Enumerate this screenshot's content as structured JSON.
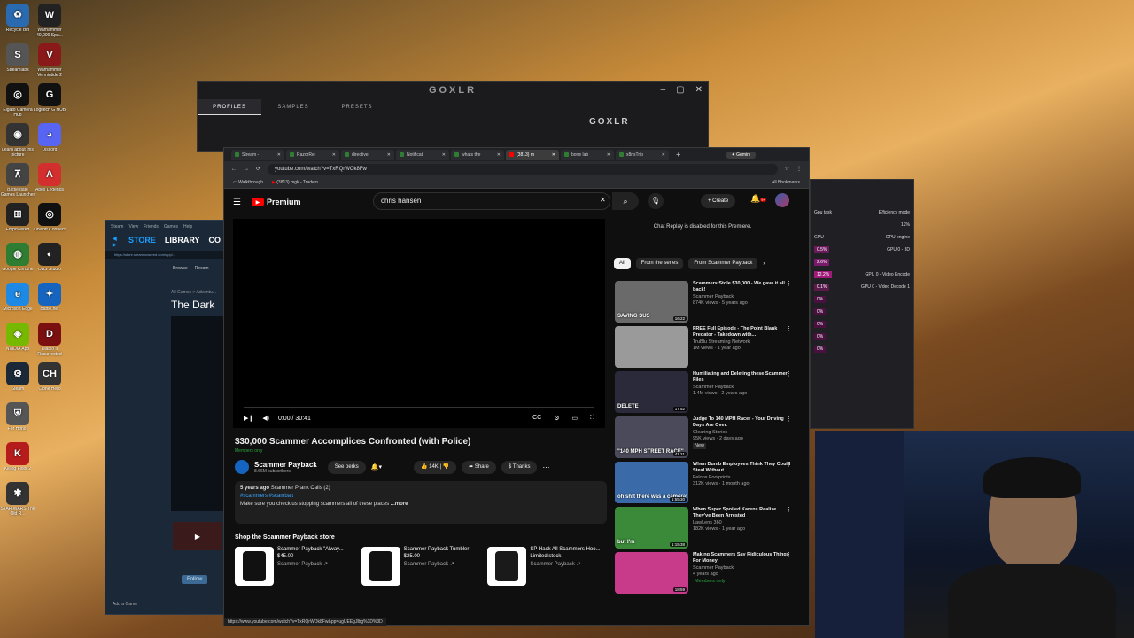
{
  "desktop": {
    "left_icons": [
      {
        "label": "Recycle Bin",
        "color": "#2a6ab0",
        "glyph": "♻"
      },
      {
        "label": "Streamlabs",
        "color": "#555555",
        "glyph": "S"
      },
      {
        "label": "Elgato Camera Hub",
        "color": "#111111",
        "glyph": "◎"
      },
      {
        "label": "Learn about this picture",
        "color": "#333333",
        "glyph": "◉"
      },
      {
        "label": "Battlestate Games Launcher",
        "color": "#444444",
        "glyph": "⊼"
      },
      {
        "label": "Empowered",
        "color": "#222222",
        "glyph": "⊞"
      },
      {
        "label": "Google Chrome",
        "color": "#2e7d32",
        "glyph": "◍"
      },
      {
        "label": "Microsoft Edge",
        "color": "#1e88e5",
        "glyph": "e"
      },
      {
        "label": "NVIDIA App",
        "color": "#76b900",
        "glyph": "◈"
      },
      {
        "label": "Steam",
        "color": "#1b2838",
        "glyph": "⚙"
      },
      {
        "label": "For Honor",
        "color": "#555555",
        "glyph": "⛨"
      },
      {
        "label": "Killing Floor 2",
        "color": "#b71c1c",
        "glyph": "K"
      },
      {
        "label": "STAR WARS The Old R...",
        "color": "#333333",
        "glyph": "✱"
      }
    ],
    "right_icons": [
      {
        "label": "Warhammer 40,000 Spa...",
        "color": "#222222",
        "glyph": "W"
      },
      {
        "label": "Warhammer Vermintide 2",
        "color": "#8a1a1a",
        "glyph": "V"
      },
      {
        "label": "Logitech G HUB",
        "color": "#111111",
        "glyph": "G"
      },
      {
        "label": "Discord",
        "color": "#5865f2",
        "glyph": "◕"
      },
      {
        "label": "Apex Legends",
        "color": "#d32f2f",
        "glyph": "A"
      },
      {
        "label": "Ubisoft Connect",
        "color": "#111111",
        "glyph": "◎"
      },
      {
        "label": "OBS Studio",
        "color": "#222222",
        "glyph": "◐"
      },
      {
        "label": "Battle.net",
        "color": "#1565c0",
        "glyph": "✦"
      },
      {
        "label": "Diablo II Resurrected",
        "color": "#7a1010",
        "glyph": "D"
      },
      {
        "label": "Clone Hero",
        "color": "#333333",
        "glyph": "CH"
      }
    ]
  },
  "goxlr": {
    "title": "GOXLR",
    "tabs": [
      "PROFILES",
      "SAMPLES",
      "PRESETS"
    ],
    "device_label": "GOXLR"
  },
  "steam": {
    "menu": [
      "Steam",
      "View",
      "Friends",
      "Games",
      "Help"
    ],
    "nav": [
      "STORE",
      "LIBRARY",
      "CO"
    ],
    "url": "https://store.steampowered.com/app/...",
    "browse": "Browse",
    "recommend": "Recom",
    "breadcrumb": "All Games > Adventu...",
    "game_title": "The Dark",
    "follow": "Follow",
    "add_game": "Add a Game"
  },
  "taskmgr": {
    "header_left": "Gpu task",
    "header_right": "Efficiency mode",
    "col1": "GPU",
    "col2": "GPU engine",
    "top_pct": "12%",
    "rows": [
      {
        "pct": "0.5%",
        "engine": "GPU 0 - 3D",
        "color": "#6a1a5a"
      },
      {
        "pct": "2.6%",
        "engine": "",
        "color": "#7a1a6a"
      },
      {
        "pct": "12.2%",
        "engine": "GPU 0 - Video Encode",
        "color": "#a01a7a"
      },
      {
        "pct": "0.1%",
        "engine": "GPU 0 - Video Decode 1",
        "color": "#5a1a4a"
      },
      {
        "pct": "0%",
        "engine": "",
        "color": "#4a1040"
      },
      {
        "pct": "0%",
        "engine": "",
        "color": "#4a1040"
      },
      {
        "pct": "0%",
        "engine": "",
        "color": "#4a1040"
      },
      {
        "pct": "0%",
        "engine": "",
        "color": "#4a1040"
      },
      {
        "pct": "0%",
        "engine": "",
        "color": "#4a1040"
      }
    ]
  },
  "browser": {
    "tabs": [
      "Stream -",
      "RazorRe",
      "directive",
      "Notificat",
      "whats the",
      "(3813) m",
      "bone lab",
      "x8nsTrip"
    ],
    "active_tab_index": 5,
    "gemini": "Gemini",
    "url": "youtube.com/watch?v=TxRQrWOk8Fw",
    "bookmarks": [
      "Walkthrough",
      "(3813) mgk - Tradem..."
    ],
    "all_bookmarks": "All Bookmarks",
    "status_url": "https://www.youtube.com/watch?v=TxRQrWOk8Fw&pp=ugUEEgJlbg%3D%3D"
  },
  "youtube": {
    "logo_text": "Premium",
    "search_value": "chris hansen",
    "create_label": "Create",
    "notif_count": "9+",
    "player": {
      "time": "0:00 / 30:41"
    },
    "video": {
      "title": "$30,000 Scammer Accomplices Confronted (with Police)",
      "members_only": "Members only",
      "channel": "Scammer Payback",
      "subscribers": "8.66M subscribers",
      "perks_label": "See perks",
      "likes": "14K",
      "share": "Share",
      "thanks": "Thanks",
      "posted": "5 years ago",
      "playlist": "Scammer Prank Calls (2)",
      "hashtags": "#scammers #scambait",
      "description": "Make sure you check us stopping scammers all of these places",
      "more": "...more"
    },
    "shop": {
      "title": "Shop the Scammer Payback store",
      "items": [
        {
          "name": "Scammer Payback \"Alway...",
          "price": "$45.00",
          "channel": "Scammer Payback ↗",
          "color": "#111111"
        },
        {
          "name": "Scammer Payback Tumbler",
          "price": "$25.00",
          "channel": "Scammer Payback ↗",
          "color": "#111111"
        },
        {
          "name": "SP Hack All Scammers Hoo...",
          "price": "Limited stock",
          "channel": "Scammer Payback ↗",
          "color": "#1a1a1a"
        }
      ]
    },
    "chat_replay": "Chat Replay is disabled for this Premiere.",
    "chips": [
      "All",
      "From the series",
      "From Scammer Payback"
    ],
    "recommendations": [
      {
        "title": "Scammers Stole $30,000 - We gave it all back!",
        "channel": "Scammer Payback",
        "meta": "874K views · 5 years ago",
        "duration": "16:22",
        "thumb": "#6a6a6a",
        "thumb_text": "SAVING SUS",
        "new": ""
      },
      {
        "title": "FREE Full Episode - The Point Blank Predator - Takedown with...",
        "channel": "TruBlu Streaming Network",
        "meta": "1M views · 1 year ago",
        "duration": "",
        "thumb": "#9a9a9a",
        "thumb_text": "",
        "new": ""
      },
      {
        "title": "Humiliating and Deleting these Scammer Files",
        "channel": "Scammer Payback",
        "meta": "1.4M views · 2 years ago",
        "duration": "17:52",
        "thumb": "#2a2a3a",
        "thumb_text": "DELETE",
        "new": ""
      },
      {
        "title": "Judge To 140 MPH Racer - Your Driving Days Are Over.",
        "channel": "Clearing Stories",
        "meta": "95K views · 2 days ago",
        "duration": "41:21",
        "thumb": "#4a4a5a",
        "thumb_text": "\"140 MPH STREET RACE\"",
        "new": "New"
      },
      {
        "title": "When Dumb Employees Think They Could Steal Without ...",
        "channel": "Felons Footprints",
        "meta": "312K views · 1 month ago",
        "duration": "1:55:30",
        "thumb": "#3a6aa8",
        "thumb_text": "oh sh!t there was a camera!",
        "new": ""
      },
      {
        "title": "When Super Spoiled Karens Realize They've Been Arrested",
        "channel": "LawLens 360",
        "meta": "182K views · 1 year ago",
        "duration": "1:15:38",
        "thumb": "#3a8a3a",
        "thumb_text": "but I'm",
        "new": ""
      },
      {
        "title": "Making Scammers Say Ridiculous Things For Money",
        "channel": "Scammer Payback",
        "meta": "4 years ago",
        "duration": "18:59",
        "thumb": "#c83a8a",
        "thumb_text": "",
        "new": "Members only"
      }
    ]
  }
}
